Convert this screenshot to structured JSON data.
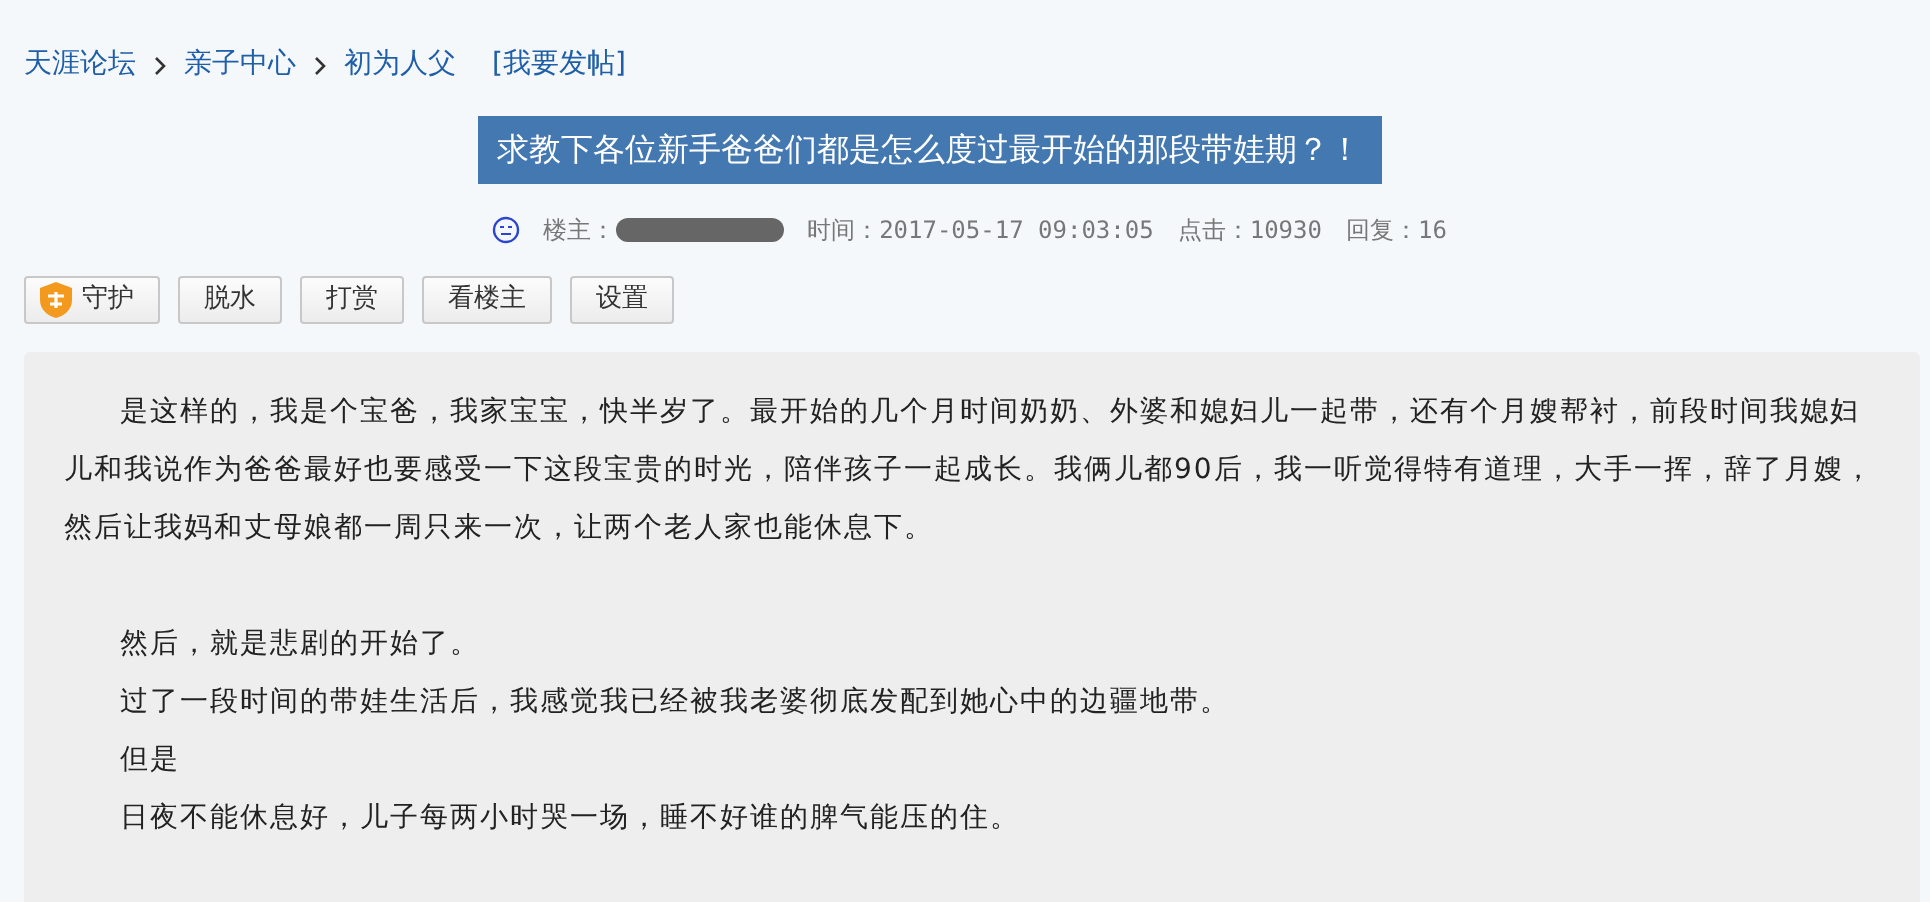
{
  "breadcrumb": [
    {
      "label": "天涯论坛"
    },
    {
      "label": "亲子中心"
    },
    {
      "label": "初为人父"
    }
  ],
  "post_link": "[我要发帖]",
  "title": "求教下各位新手爸爸们都是怎么度过最开始的那段带娃期？！",
  "meta": {
    "author_label": "楼主：",
    "time": "时间：2017-05-17 09:03:05",
    "clicks": "点击：10930",
    "replies": "回复：16"
  },
  "buttons": [
    {
      "label": "守护",
      "kind": "shield"
    },
    {
      "label": "脱水",
      "kind": "plain"
    },
    {
      "label": "打赏",
      "kind": "plain"
    },
    {
      "label": "看楼主",
      "kind": "plain"
    },
    {
      "label": "设置",
      "kind": "plain"
    }
  ],
  "sections": [
    {
      "lines": [
        "是这样的，我是个宝爸，我家宝宝，快半岁了。最开始的几个月时间奶奶、外婆和媳妇儿一起带，还有个月嫂帮衬，前段时间我媳妇儿和我说作为爸爸最好也要感受一下这段宝贵的时光，陪伴孩子一起成长。我俩儿都90后，我一听觉得特有道理，大手一挥，辞了月嫂，然后让我妈和丈母娘都一周只来一次，让两个老人家也能休息下。"
      ]
    },
    {
      "lines": [
        "然后，就是悲剧的开始了。",
        "过了一段时间的带娃生活后，我感觉我已经被我老婆彻底发配到她心中的边疆地带。",
        "但是",
        "日夜不能休息好，儿子每两小时哭一场，睡不好谁的脾气能压的住。"
      ]
    }
  ]
}
